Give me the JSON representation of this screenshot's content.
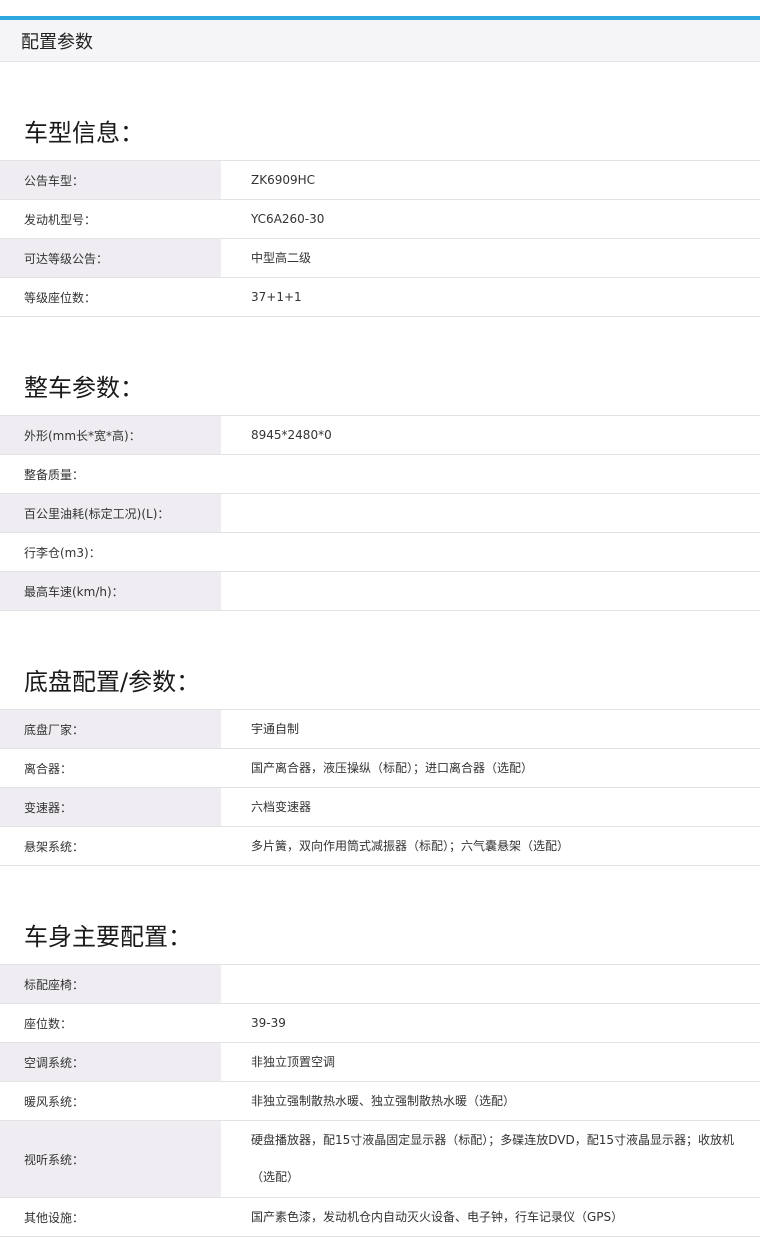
{
  "header": {
    "title": "配置参数"
  },
  "sections": [
    {
      "title": "车型信息：",
      "rows": [
        {
          "label": "公告车型：",
          "value": "ZK6909HC"
        },
        {
          "label": "发动机型号：",
          "value": "YC6A260-30"
        },
        {
          "label": "可达等级公告：",
          "value": "中型高二级"
        },
        {
          "label": "等级座位数：",
          "value": "37+1+1"
        }
      ]
    },
    {
      "title": "整车参数：",
      "rows": [
        {
          "label": "外形(mm长*宽*高)：",
          "value": "8945*2480*0"
        },
        {
          "label": "整备质量：",
          "value": ""
        },
        {
          "label": "百公里油耗(标定工况)(L)：",
          "value": ""
        },
        {
          "label": "行李仓(m3)：",
          "value": ""
        },
        {
          "label": "最高车速(km/h)：",
          "value": ""
        }
      ]
    },
    {
      "title": "底盘配置/参数：",
      "rows": [
        {
          "label": "底盘厂家：",
          "value": "宇通自制"
        },
        {
          "label": "离合器：",
          "value": "国产离合器，液压操纵（标配）；进口离合器（选配）"
        },
        {
          "label": "变速器：",
          "value": "六档变速器"
        },
        {
          "label": "悬架系统：",
          "value": "多片簧，双向作用筒式减振器（标配）；六气囊悬架（选配）"
        }
      ]
    },
    {
      "title": "车身主要配置：",
      "rows": [
        {
          "label": "标配座椅：",
          "value": ""
        },
        {
          "label": "座位数：",
          "value": "39-39"
        },
        {
          "label": "空调系统：",
          "value": "非独立顶置空调"
        },
        {
          "label": "暖风系统：",
          "value": "非独立强制散热水暖、独立强制散热水暖（选配）"
        },
        {
          "label": "视听系统：",
          "value": "硬盘播放器，配15寸液晶固定显示器（标配）；多碟连放DVD，配15寸液晶显示器；收放机（选配）"
        },
        {
          "label": "其他设施：",
          "value": "国产素色漆，发动机仓内自动灭火设备、电子钟，行车记录仪（GPS）"
        }
      ]
    }
  ]
}
